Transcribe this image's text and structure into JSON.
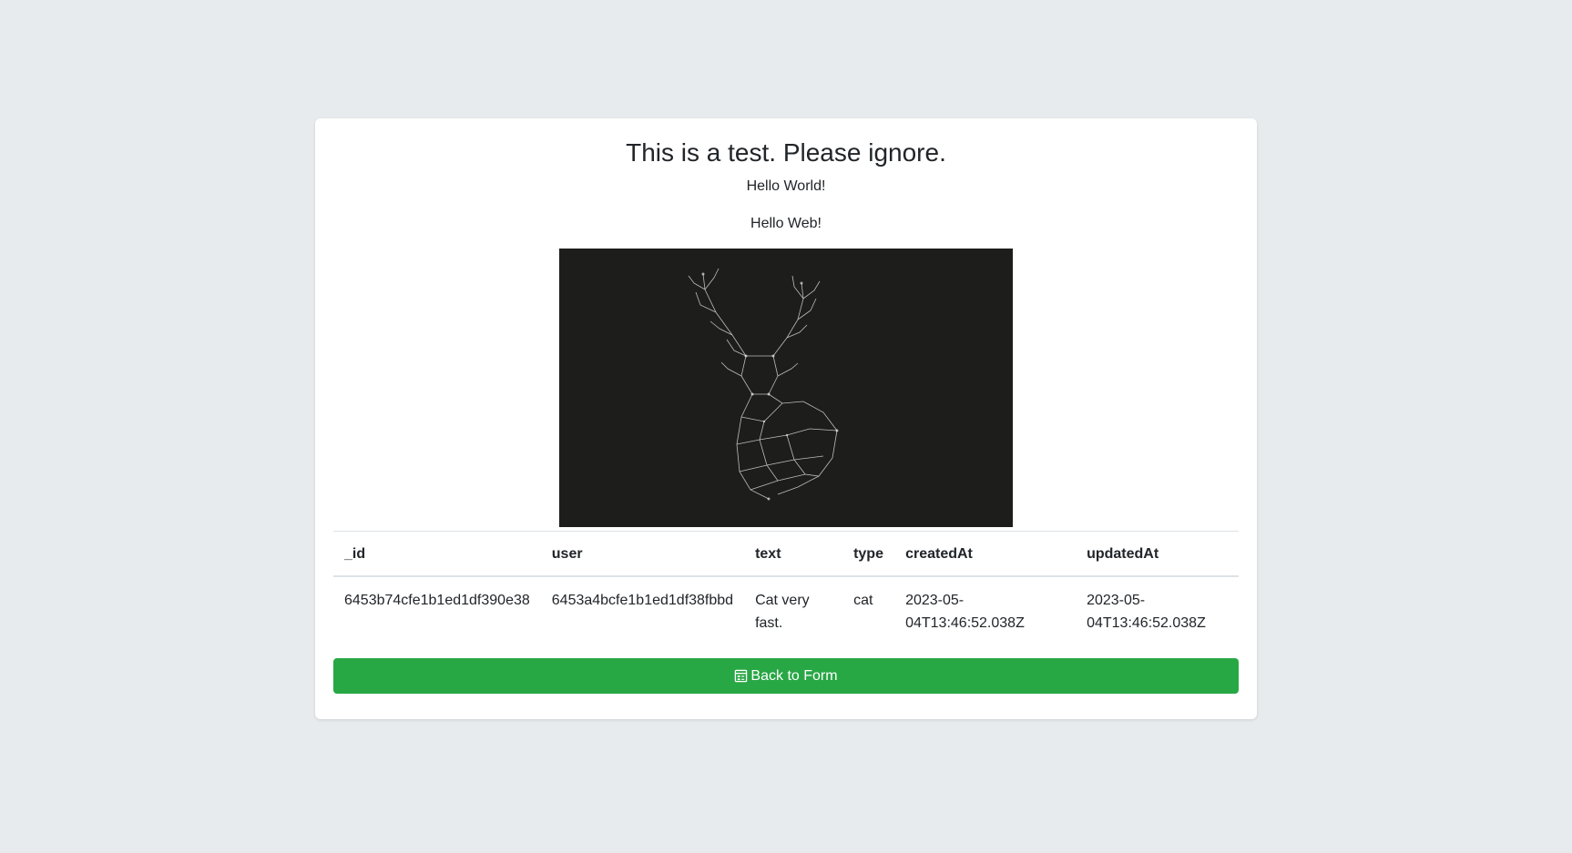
{
  "heading": "This is a test. Please ignore.",
  "paragraphs": [
    "Hello World!",
    "Hello Web!"
  ],
  "image": {
    "description_icon": "deer-head-low-poly-image",
    "background": "#1d1d1b"
  },
  "table": {
    "headers": [
      "_id",
      "user",
      "text",
      "type",
      "createdAt",
      "updatedAt"
    ],
    "rows": [
      [
        "6453b74cfe1b1ed1df390e38",
        "6453a4bcfe1b1ed1df38fbbd",
        "Cat very fast.",
        "cat",
        "2023-05-04T13:46:52.038Z",
        "2023-05-04T13:46:52.038Z"
      ]
    ]
  },
  "button": {
    "label": "Back to Form",
    "icon": "form-icon",
    "color": "#28a745"
  },
  "colors": {
    "page_background": "#e8ebee",
    "card_background": "#ffffff"
  }
}
